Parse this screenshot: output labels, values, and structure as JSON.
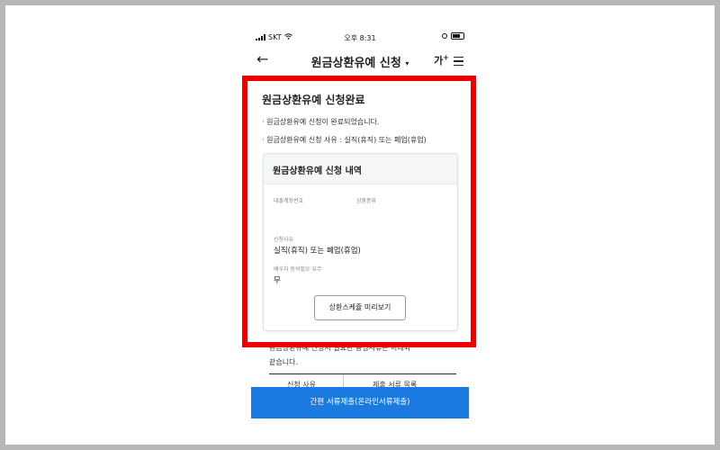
{
  "status_bar": {
    "carrier": "SKT",
    "time": "오후 8:31"
  },
  "header": {
    "back_icon": "arrow-left-icon",
    "title": "원금상환유예 신청",
    "caret": "▾",
    "font_size_label": "가",
    "font_size_plus": "+",
    "menu_icon": "hamburger-menu-icon"
  },
  "completion": {
    "title": "원금상환유예 신청완료",
    "bullets": [
      "· 원금상환유예 신청이 완료되었습니다.",
      "· 원금상환유예 신청 사유 : 실직(휴직) 또는 폐업(휴업)"
    ]
  },
  "card": {
    "title": "원금상환유예 신청 내역",
    "account_label": "대출계좌번호",
    "product_label": "상품종류",
    "reason_label": "신청사유",
    "reason_value": "실직(휴직) 또는 폐업(휴업)",
    "spouse_label": "배우자 동의필요 유무",
    "spouse_value": "무",
    "preview_button": "상환스케쥴 미리보기"
  },
  "below": {
    "line1": "원금상환유예 신청시 필요한 증빙서류는 아래와",
    "line2": "같습니다.",
    "tabs": [
      "신청 사유",
      "제출 서류 목록"
    ]
  },
  "submit_button": "간편 서류제출(온라인서류제출)",
  "colors": {
    "highlight": "#ee0000",
    "primary_button": "#1a7ae0"
  }
}
